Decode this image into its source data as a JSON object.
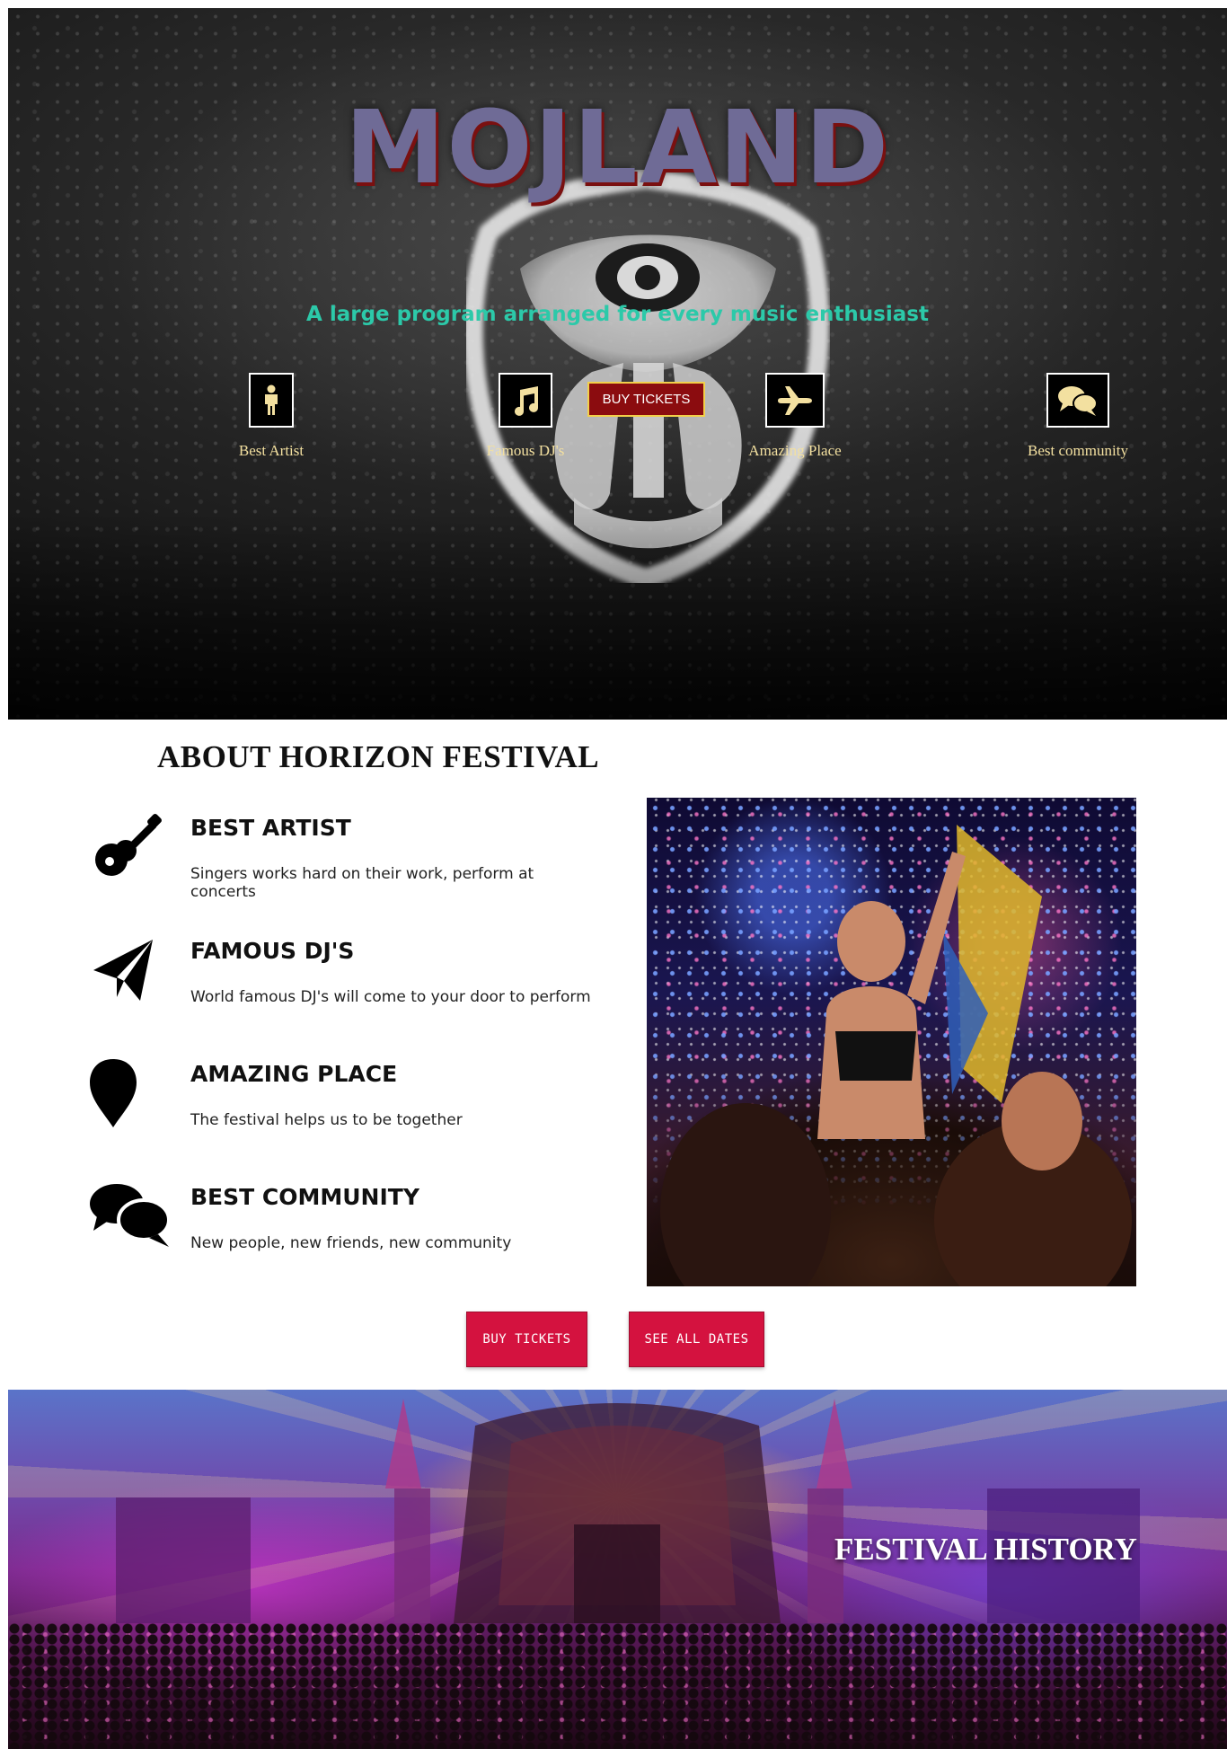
{
  "hero": {
    "brand": "MOJLAND",
    "tagline": "A large program arranged for every music enthusiast",
    "cta": "BUY TICKETS",
    "features": [
      {
        "label": "Best Artist",
        "icon": "person-icon"
      },
      {
        "label": "Famous DJ's",
        "icon": "music-note-icon"
      },
      {
        "label": "Amazing Place",
        "icon": "airplane-icon"
      },
      {
        "label": "Best community",
        "icon": "chat-bubbles-icon"
      }
    ]
  },
  "about": {
    "title": "ABOUT HORIZON FESTIVAL",
    "items": [
      {
        "heading": "BEST ARTIST",
        "text": "Singers works hard on their work, perform at concerts",
        "icon": "guitar-icon"
      },
      {
        "heading": "FAMOUS DJ'S",
        "text": "World famous DJ's will come to your door to perform",
        "icon": "paper-plane-icon"
      },
      {
        "heading": "AMAZING PLACE",
        "text": "The festival helps us to be together",
        "icon": "map-pin-icon"
      },
      {
        "heading": "BEST COMMUNITY",
        "text": "New people, new friends, new community",
        "icon": "chat-bubbles-icon"
      }
    ],
    "buttons": {
      "buy": "BUY TICKETS",
      "dates": "SEE ALL DATES"
    }
  },
  "history": {
    "title": "FESTIVAL HISTORY"
  },
  "colors": {
    "brand": "#6f6b96",
    "tagline": "#2cc9a9",
    "hero_cta": "#8b0c0f",
    "feature_label": "#f3e0a0",
    "red_button": "#d4123f"
  }
}
